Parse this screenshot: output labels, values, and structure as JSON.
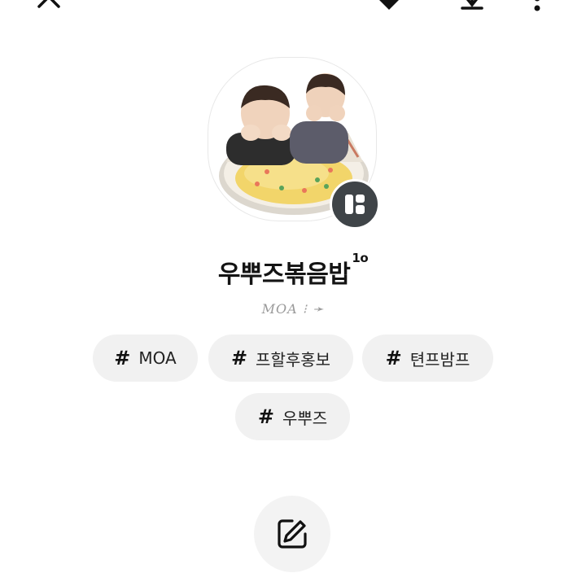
{
  "topbar": {
    "icons": [
      "close-icon",
      "heart-icon",
      "share-icon",
      "more-icon"
    ]
  },
  "profile": {
    "title": "우뿌즈볶음밥",
    "title_sup": "1o",
    "subtitle": "MOA ⁝ ➛",
    "image_caption": "우뿌즈볶음밥"
  },
  "tags": [
    {
      "hash": "#",
      "label": "MOA"
    },
    {
      "hash": "#",
      "label": "프할후홍보"
    },
    {
      "hash": "#",
      "label": "텬프밤프"
    },
    {
      "hash": "#",
      "label": "우뿌즈"
    }
  ],
  "actions": {
    "edit_icon": "edit-icon"
  },
  "colors": {
    "tag_bg": "#f1f1f1",
    "badge_bg": "#3f4448",
    "edit_bg": "#f3f3f3"
  }
}
